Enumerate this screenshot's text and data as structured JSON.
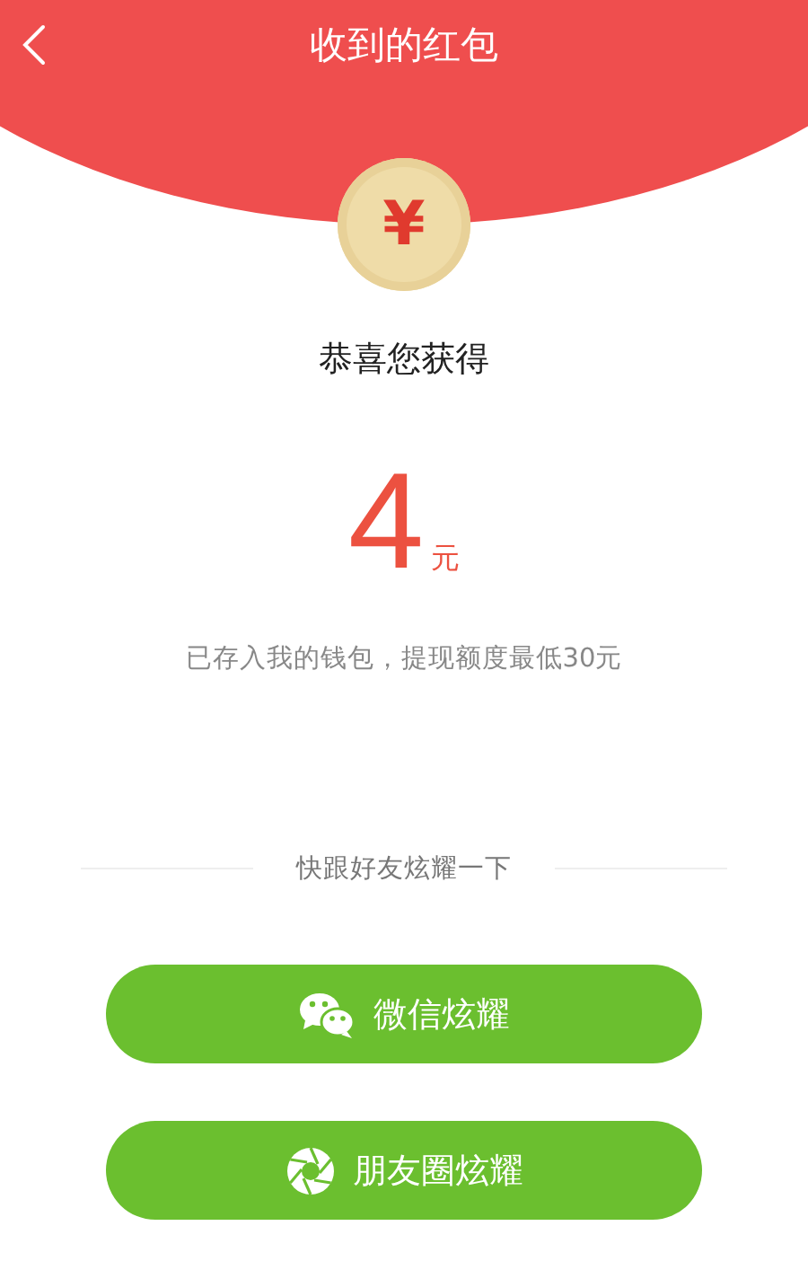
{
  "header": {
    "title": "收到的红包"
  },
  "coin": {
    "symbol": "¥"
  },
  "greeting": "恭喜您获得",
  "amount": {
    "value": "4",
    "unit": "元"
  },
  "note": "已存入我的钱包，提现额度最低30元",
  "share": {
    "prompt": "快跟好友炫耀一下",
    "buttons": [
      {
        "kind": "chat",
        "label": "微信炫耀"
      },
      {
        "kind": "shutter",
        "label": "朋友圈炫耀"
      }
    ]
  }
}
